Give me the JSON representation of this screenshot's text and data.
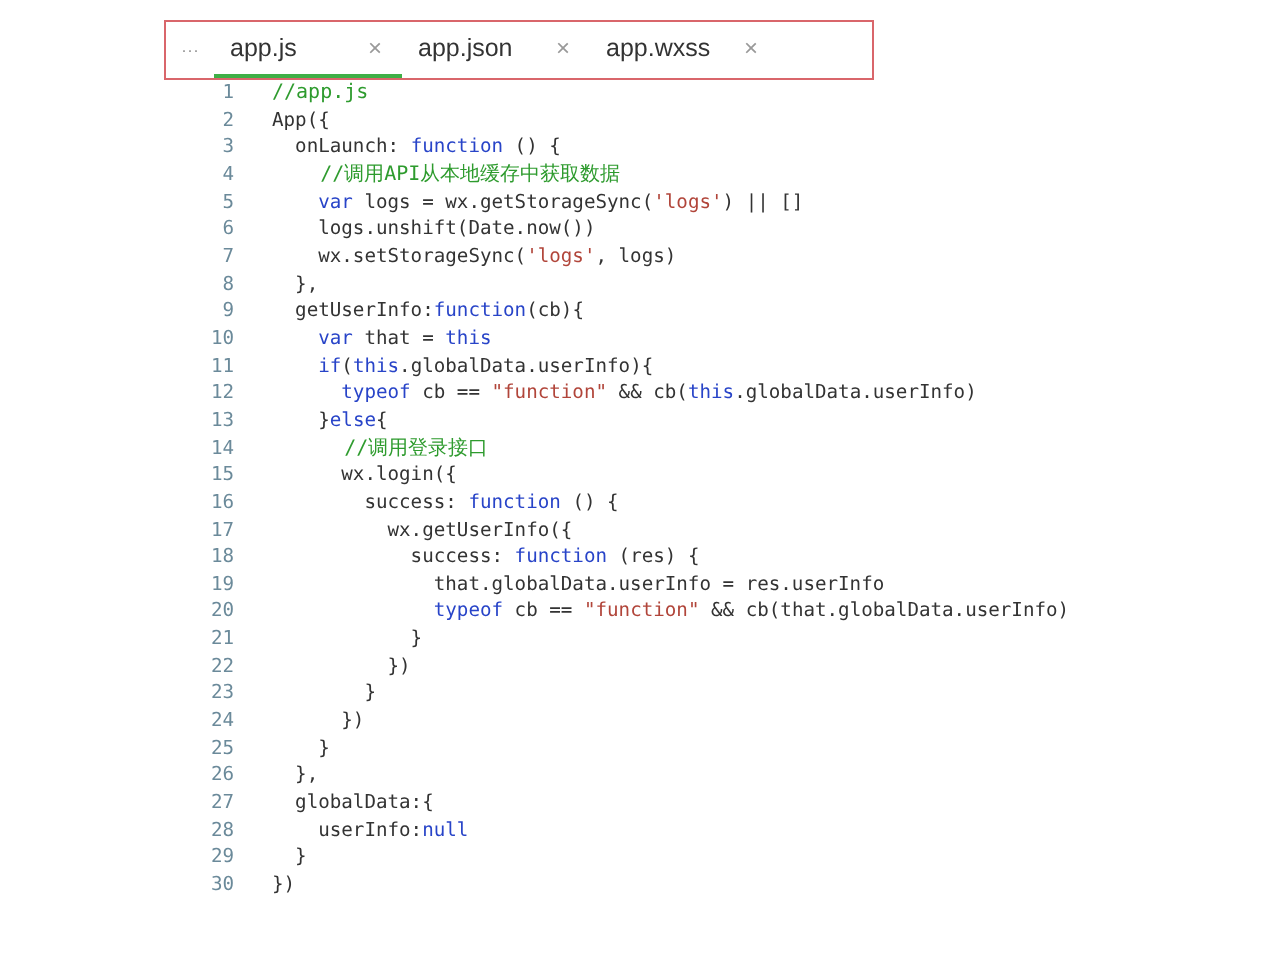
{
  "tab_bar": {
    "overflow": "···",
    "tabs": [
      {
        "label": "app.js",
        "close": "×",
        "selected": true
      },
      {
        "label": "app.json",
        "close": "×",
        "selected": false
      },
      {
        "label": "app.wxss",
        "close": "×",
        "selected": false
      }
    ]
  },
  "editor": {
    "lines": [
      {
        "number": "1",
        "tokens": [
          {
            "kind": "comment",
            "text": "//app.js"
          }
        ]
      },
      {
        "number": "2",
        "tokens": [
          {
            "kind": "plain",
            "text": "App({"
          }
        ]
      },
      {
        "number": "3",
        "tokens": [
          {
            "kind": "plain",
            "text": "  onLaunch: "
          },
          {
            "kind": "keyword",
            "text": "function"
          },
          {
            "kind": "plain",
            "text": " () {"
          }
        ]
      },
      {
        "number": "4",
        "tokens": [
          {
            "kind": "comment",
            "text": "    //调用API从本地缓存中获取数据"
          }
        ]
      },
      {
        "number": "5",
        "tokens": [
          {
            "kind": "keyword",
            "text": "    var"
          },
          {
            "kind": "plain",
            "text": " logs = wx.getStorageSync("
          },
          {
            "kind": "string",
            "text": "'logs'"
          },
          {
            "kind": "plain",
            "text": ") || []"
          }
        ]
      },
      {
        "number": "6",
        "tokens": [
          {
            "kind": "plain",
            "text": "    logs.unshift(Date.now())"
          }
        ]
      },
      {
        "number": "7",
        "tokens": [
          {
            "kind": "plain",
            "text": "    wx.setStorageSync("
          },
          {
            "kind": "string",
            "text": "'logs'"
          },
          {
            "kind": "plain",
            "text": ", logs)"
          }
        ]
      },
      {
        "number": "8",
        "tokens": [
          {
            "kind": "plain",
            "text": "  },"
          }
        ]
      },
      {
        "number": "9",
        "tokens": [
          {
            "kind": "plain",
            "text": "  getUserInfo:"
          },
          {
            "kind": "keyword",
            "text": "function"
          },
          {
            "kind": "plain",
            "text": "(cb){"
          }
        ]
      },
      {
        "number": "10",
        "tokens": [
          {
            "kind": "keyword",
            "text": "    var"
          },
          {
            "kind": "plain",
            "text": " that = "
          },
          {
            "kind": "keyword",
            "text": "this"
          }
        ]
      },
      {
        "number": "11",
        "tokens": [
          {
            "kind": "keyword",
            "text": "    if"
          },
          {
            "kind": "plain",
            "text": "("
          },
          {
            "kind": "keyword",
            "text": "this"
          },
          {
            "kind": "plain",
            "text": ".globalData.userInfo){"
          }
        ]
      },
      {
        "number": "12",
        "tokens": [
          {
            "kind": "keyword",
            "text": "      typeof"
          },
          {
            "kind": "plain",
            "text": " cb == "
          },
          {
            "kind": "string",
            "text": "\"function\""
          },
          {
            "kind": "plain",
            "text": " && cb("
          },
          {
            "kind": "keyword",
            "text": "this"
          },
          {
            "kind": "plain",
            "text": ".globalData.userInfo)"
          }
        ]
      },
      {
        "number": "13",
        "tokens": [
          {
            "kind": "plain",
            "text": "    }"
          },
          {
            "kind": "keyword",
            "text": "else"
          },
          {
            "kind": "plain",
            "text": "{"
          }
        ]
      },
      {
        "number": "14",
        "tokens": [
          {
            "kind": "comment",
            "text": "      //调用登录接口"
          }
        ]
      },
      {
        "number": "15",
        "tokens": [
          {
            "kind": "plain",
            "text": "      wx.login({"
          }
        ]
      },
      {
        "number": "16",
        "tokens": [
          {
            "kind": "plain",
            "text": "        success: "
          },
          {
            "kind": "keyword",
            "text": "function"
          },
          {
            "kind": "plain",
            "text": " () {"
          }
        ]
      },
      {
        "number": "17",
        "tokens": [
          {
            "kind": "plain",
            "text": "          wx.getUserInfo({"
          }
        ]
      },
      {
        "number": "18",
        "tokens": [
          {
            "kind": "plain",
            "text": "            success: "
          },
          {
            "kind": "keyword",
            "text": "function"
          },
          {
            "kind": "plain",
            "text": " (res) {"
          }
        ]
      },
      {
        "number": "19",
        "tokens": [
          {
            "kind": "plain",
            "text": "              that.globalData.userInfo = res.userInfo"
          }
        ]
      },
      {
        "number": "20",
        "tokens": [
          {
            "kind": "keyword",
            "text": "              typeof"
          },
          {
            "kind": "plain",
            "text": " cb == "
          },
          {
            "kind": "string",
            "text": "\"function\""
          },
          {
            "kind": "plain",
            "text": " && cb(that.globalData.userInfo)"
          }
        ]
      },
      {
        "number": "21",
        "tokens": [
          {
            "kind": "plain",
            "text": "            }"
          }
        ]
      },
      {
        "number": "22",
        "tokens": [
          {
            "kind": "plain",
            "text": "          })"
          }
        ]
      },
      {
        "number": "23",
        "tokens": [
          {
            "kind": "plain",
            "text": "        }"
          }
        ]
      },
      {
        "number": "24",
        "tokens": [
          {
            "kind": "plain",
            "text": "      })"
          }
        ]
      },
      {
        "number": "25",
        "tokens": [
          {
            "kind": "plain",
            "text": "    }"
          }
        ]
      },
      {
        "number": "26",
        "tokens": [
          {
            "kind": "plain",
            "text": "  },"
          }
        ]
      },
      {
        "number": "27",
        "tokens": [
          {
            "kind": "plain",
            "text": "  globalData:{"
          }
        ]
      },
      {
        "number": "28",
        "tokens": [
          {
            "kind": "plain",
            "text": "    userInfo:"
          },
          {
            "kind": "keyword",
            "text": "null"
          }
        ]
      },
      {
        "number": "29",
        "tokens": [
          {
            "kind": "plain",
            "text": "  }"
          }
        ]
      },
      {
        "number": "30",
        "tokens": [
          {
            "kind": "plain",
            "text": "})"
          }
        ]
      }
    ]
  }
}
